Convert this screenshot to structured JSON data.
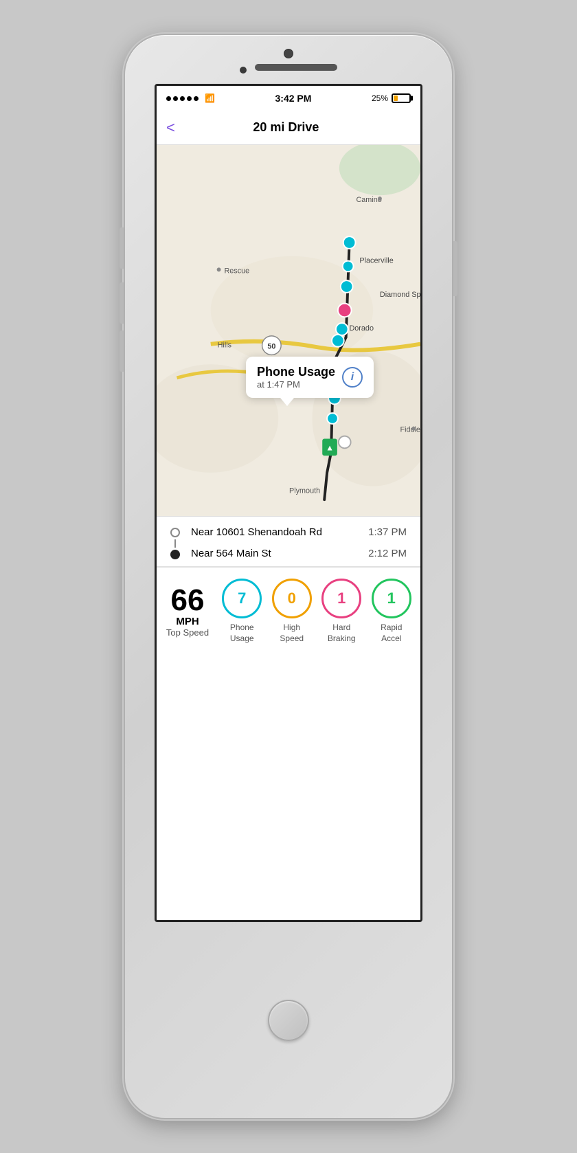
{
  "statusBar": {
    "time": "3:42 PM",
    "batteryPct": "25%",
    "signalDots": 5
  },
  "navBar": {
    "backLabel": "<",
    "title": "20 mi Drive"
  },
  "map": {
    "tooltip": {
      "title": "Phone Usage",
      "sub": "at 1:47 PM"
    },
    "places": [
      "Rescue",
      "Hills",
      "Camino",
      "Placerville",
      "Diamond Springs",
      "El Dorado",
      "Fiddletown",
      "Plymouth"
    ]
  },
  "tripDetails": {
    "origin": "Near 10601 Shenandoah Rd",
    "originTime": "1:37 PM",
    "destination": "Near 564 Main St",
    "destinationTime": "2:12 PM"
  },
  "stats": {
    "topSpeedNumber": "66",
    "topSpeedUnit": "MPH",
    "topSpeedLabel": "Top Speed",
    "items": [
      {
        "value": "7",
        "label": "Phone\nUsage",
        "color": "cyan"
      },
      {
        "value": "0",
        "label": "High\nSpeed",
        "color": "orange"
      },
      {
        "value": "1",
        "label": "Hard\nBraking",
        "color": "pink"
      },
      {
        "value": "1",
        "label": "Rapid\nAccel",
        "color": "green"
      }
    ]
  }
}
